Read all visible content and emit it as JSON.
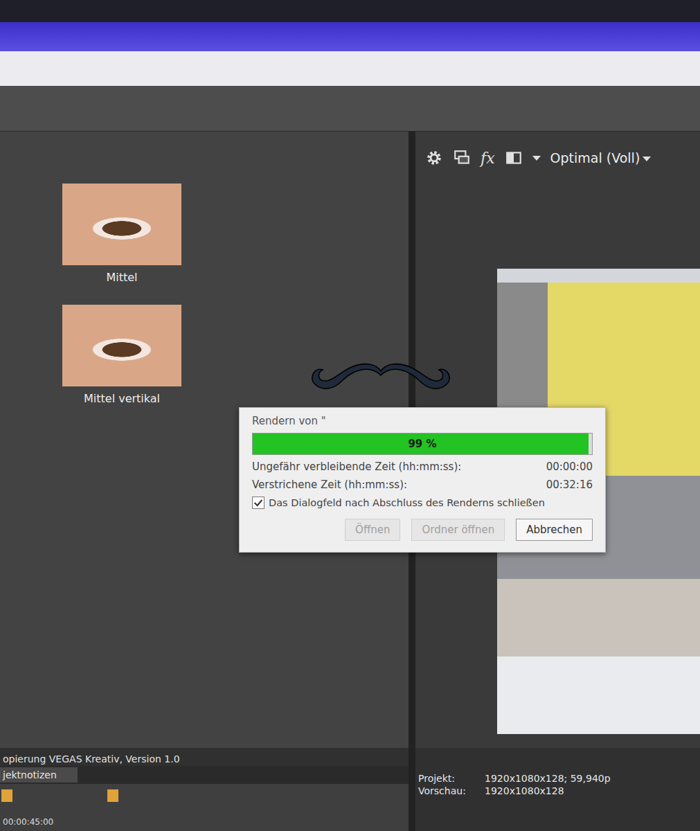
{
  "left_panel": {
    "presets": [
      {
        "label": "Mittel",
        "selected": false
      },
      {
        "label": "Mittel vertikal",
        "selected": false
      }
    ]
  },
  "preview_toolbar": {
    "fx_label": "fx",
    "quality": "Optimal (Voll)"
  },
  "render_dialog": {
    "title": "Rendern von \"",
    "progress": {
      "level": 0.99,
      "reading": "99 %"
    },
    "rows": [
      {
        "label": "Ungefähr verbleibende Zeit (hh:mm:ss):",
        "value": "00:00:00"
      },
      {
        "label": "Verstrichene Zeit (hh:mm:ss):",
        "value": "00:32:16"
      }
    ],
    "close_checkbox": {
      "label": "Das Dialogfeld nach Abschluss des Renderns schließen",
      "checked": true
    },
    "buttons": [
      {
        "label": "Öffnen",
        "disabled": true
      },
      {
        "label": "Ordner öffnen",
        "disabled": true
      },
      {
        "label": "Abbrechen",
        "disabled": false
      }
    ]
  },
  "project_notes": {
    "text": "opierung VEGAS Kreativ, Version 1.0",
    "tab": "jektnotizen"
  },
  "timeline": {
    "timecode": "00:00:45:00"
  },
  "status": [
    {
      "label": "Projekt:",
      "value": "1920x1080x128; 59,940p"
    },
    {
      "label": "Vorschau:",
      "value": "1920x1080x128"
    }
  ]
}
